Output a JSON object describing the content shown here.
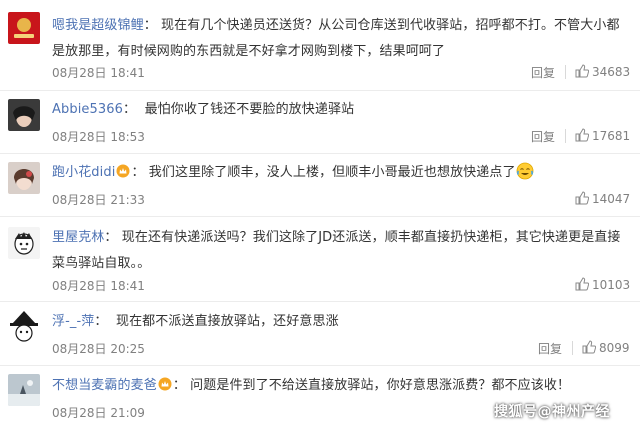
{
  "comments": [
    {
      "user": "嗯我是超级锦鲤",
      "text": "现在有几个快递员还送货？从公司仓库送到代收驿站，招呼都不打。不管大小都是放那里，有时候网购的东西就是不好拿才网购到楼下，结果呵呵了",
      "time": "08月28日 18:41",
      "reply": "回复",
      "likes": "34683"
    },
    {
      "user": "Abbie5366",
      "text": "最怕你收了钱还不要脸的放快递驿站",
      "time": "08月28日 18:53",
      "reply": "回复",
      "likes": "17681"
    },
    {
      "user": "跑小花didi",
      "text": "我们这里除了顺丰，没人上楼，但顺丰小哥最近也想放快递点了",
      "time": "08月28日 21:33",
      "reply": "回复",
      "likes": "14047"
    },
    {
      "user": "里屋克林",
      "text": "现在还有快递派送吗？我们这除了JD还派送，顺丰都直接扔快递柜，其它快递更是直接菜鸟驿站自取。。",
      "time": "08月28日 18:41",
      "reply": "回复",
      "likes": "10103"
    },
    {
      "user": "浮-_-萍",
      "text": "现在都不派送直接放驿站，还好意思涨",
      "time": "08月28日 20:25",
      "reply": "回复",
      "likes": "8099"
    },
    {
      "user": "不想当麦霸的麦爸",
      "text": "问题是件到了不给送直接放驿站，你好意思涨派费？都不应该收！",
      "time": "08月28日 21:09",
      "reply": "",
      "likes": ""
    }
  ],
  "separator": "：",
  "watermark": "搜狐号@神州产经",
  "icons": {
    "crown": "crown-icon",
    "like": "thumbs-up-icon",
    "emoji": "crying-laughing-emoji-icon"
  },
  "colors": {
    "username": "#4d72b3",
    "meta": "#808080",
    "text": "#333333"
  }
}
